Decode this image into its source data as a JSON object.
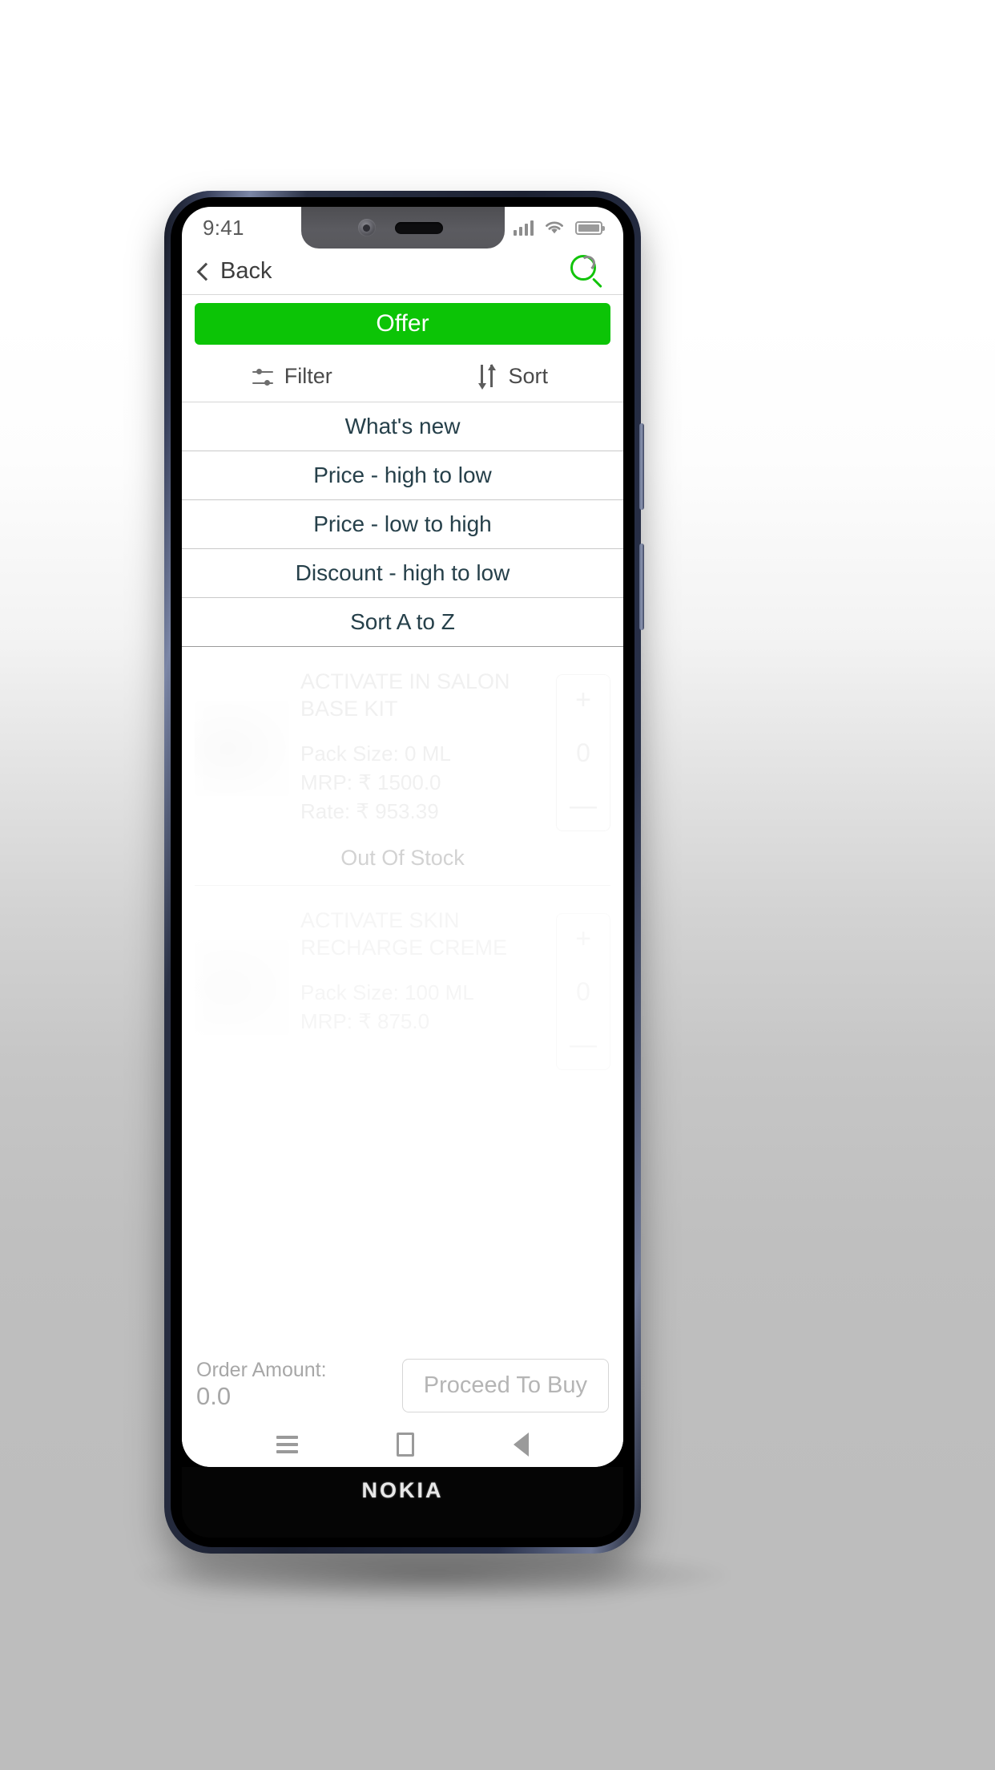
{
  "device": {
    "brand_label": "NOKIA"
  },
  "status_bar": {
    "time": "9:41",
    "signal_icon": "signal-bars-icon",
    "wifi_icon": "wifi-icon",
    "battery_icon": "battery-icon"
  },
  "nav_header": {
    "back_label": "Back",
    "back_chevron_icon": "chevron-left-icon",
    "search_icon": "search-icon"
  },
  "offer_banner": {
    "label": "Offer",
    "background_color": "#0cc406",
    "text_color": "#ffffff"
  },
  "toolbar": {
    "filter_label": "Filter",
    "filter_icon": "sliders-icon",
    "sort_label": "Sort",
    "sort_icon": "sort-arrows-icon"
  },
  "sort_menu": {
    "options": [
      {
        "label": "What's new"
      },
      {
        "label": "Price - high to low"
      },
      {
        "label": "Price - low to high"
      },
      {
        "label": "Discount - high  to low"
      },
      {
        "label": "Sort A to Z"
      }
    ],
    "text_color": "#26404a"
  },
  "products": [
    {
      "name": "ACTIVATE IN SALON BASE KIT",
      "pack_size": "Pack Size: 0 ML",
      "mrp": "MRP: ₹ 1500.0",
      "rate": "Rate: ₹ 953.39",
      "quantity": "0",
      "plus_label": "+",
      "minus_label": "—",
      "stock_status": "Out Of Stock"
    },
    {
      "name": "ACTIVATE SKIN RECHARGE CREME",
      "pack_size": "Pack Size: 100 ML",
      "mrp": "MRP: ₹ 875.0",
      "rate": "",
      "quantity": "0",
      "plus_label": "+",
      "minus_label": "—",
      "stock_status": ""
    }
  ],
  "order_bar": {
    "amount_label": "Order Amount:",
    "amount_value": "0.0",
    "proceed_label": "Proceed To Buy"
  },
  "android_nav": {
    "recents_icon": "menu-recents-icon",
    "home_icon": "home-square-icon",
    "back_icon": "back-triangle-icon"
  }
}
